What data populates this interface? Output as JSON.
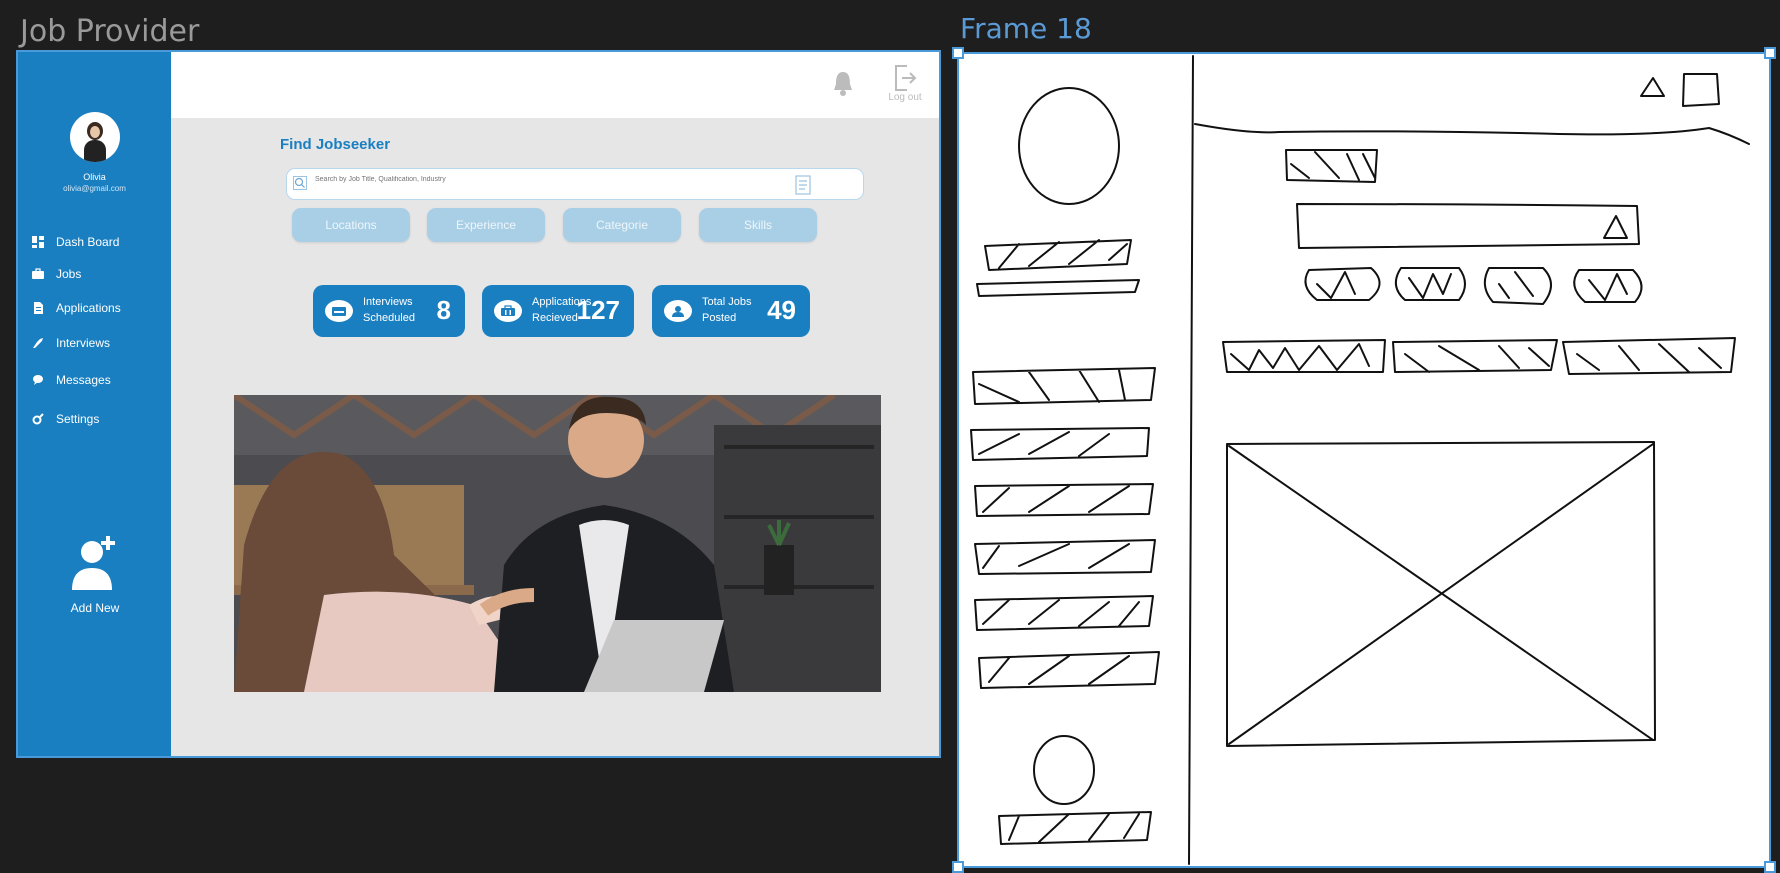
{
  "frames": {
    "left_title": "Job Provider",
    "right_title": "Frame 18"
  },
  "colors": {
    "primary": "#1a7fc1",
    "pill": "#a9cfe6",
    "frame_outline": "#4a9ad9"
  },
  "profile": {
    "name": "Olivia",
    "email": "olivia@gmail.com"
  },
  "sidebar": {
    "items": [
      {
        "label": "Dash Board",
        "icon": "dashboard-icon"
      },
      {
        "label": "Jobs",
        "icon": "briefcase-icon"
      },
      {
        "label": "Applications",
        "icon": "document-icon"
      },
      {
        "label": "Interviews",
        "icon": "handshake-icon"
      },
      {
        "label": "Messages",
        "icon": "message-icon"
      },
      {
        "label": "Settings",
        "icon": "settings-icon"
      }
    ],
    "add_new": "Add New"
  },
  "header": {
    "logout": "Log out"
  },
  "main": {
    "title": "Find Jobseeker",
    "search_placeholder": "Search by Job Title, Qualification, Industry",
    "filters": [
      "Locations",
      "Experience",
      "Categorie",
      "Skills"
    ],
    "stats": [
      {
        "line1": "Interviews",
        "line2": "Scheduled",
        "value": "8",
        "icon": "calendar-icon"
      },
      {
        "line1": "Applications",
        "line2": "Recieved",
        "value": "127",
        "icon": "briefcase-icon"
      },
      {
        "line1": "Total Jobs",
        "line2": "Posted",
        "value": "49",
        "icon": "user-icon"
      }
    ]
  }
}
